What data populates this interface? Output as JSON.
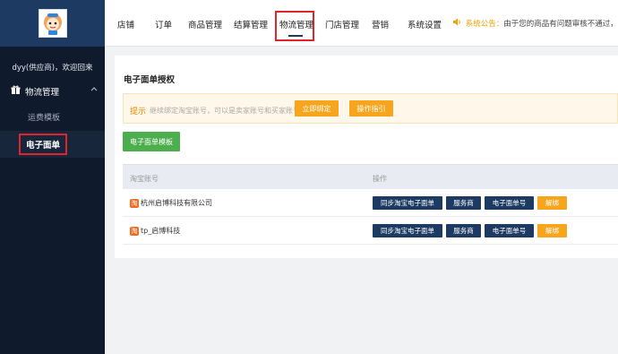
{
  "sidebar": {
    "logo_icon": "mascot-logo",
    "welcome": "dyy(供应商)，欢迎回来",
    "group_icon": "gift-icon",
    "group_label": "物流管理",
    "group_caret": "^",
    "items": [
      {
        "label": "运费模板"
      },
      {
        "label": "电子面单"
      }
    ]
  },
  "topnav": {
    "items": [
      "店铺",
      "订单",
      "商品管理",
      "结算管理",
      "物流管理",
      "门店管理",
      "营销",
      "系统设置"
    ],
    "active_index": 4,
    "notice_icon": "speaker-icon",
    "notice_label": "系统公告：",
    "notice_text": "由于您的商品有问题审核不通过，你需..."
  },
  "main": {
    "title": "电子面单授权",
    "tip_label": "提示",
    "tip_text": "继续绑定淘宝账号，可以是卖家账号和买家账号。",
    "bind_button": "立即绑定",
    "guide_button": "操作指引",
    "template_button": "电子面单模板",
    "table": {
      "headers": [
        "淘宝账号",
        "操作"
      ],
      "rows": [
        {
          "account": "杭州启博科技有限公司"
        },
        {
          "account": "tp_启博科技"
        }
      ],
      "actions": [
        "同步淘宝电子面单",
        "服务商",
        "电子面单号",
        "解绑"
      ]
    }
  },
  "colors": {
    "sidebar_bg": "#0f1b2d",
    "logo_bg": "#1d3a63",
    "accent_orange": "#f7a51c",
    "accent_green": "#4cae4c",
    "navy_button": "#1d3a63",
    "highlight_red": "#e0242c"
  }
}
